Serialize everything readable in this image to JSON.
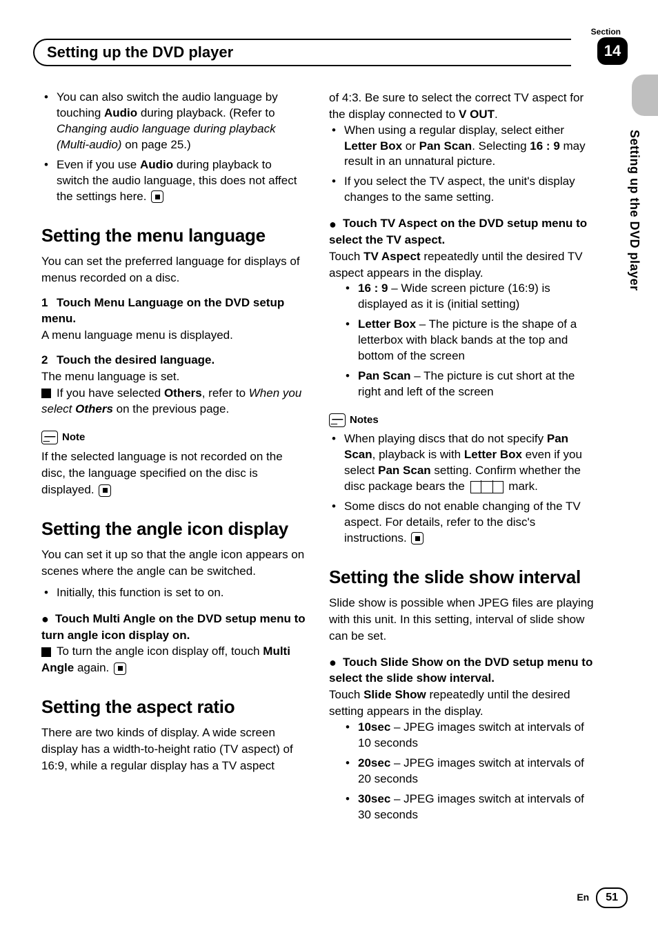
{
  "meta": {
    "section_word": "Section",
    "section_number": "14",
    "side_label": "Setting up the DVD player",
    "header_title": "Setting up the DVD player",
    "footer_lang": "En",
    "page_number": "51"
  },
  "left": {
    "top_bullets": [
      {
        "pre": "You can also switch the audio language by touching ",
        "b1": "Audio",
        "mid1": " during playback. (Refer to ",
        "i1": "Changing audio language during playback (Multi-audio)",
        "post": " on page 25.)"
      },
      {
        "pre": "Even if you use ",
        "b1": "Audio",
        "mid1": " during playback to switch the audio language, this does not affect the settings here.",
        "end_icon": true
      }
    ],
    "h_menu": "Setting the menu language",
    "p_menu": "You can set the preferred language for displays of menus recorded on a disc.",
    "step1_head": "Touch Menu Language on the DVD setup menu.",
    "step1_body": "A menu language menu is displayed.",
    "step2_head": "Touch the desired language.",
    "step2_body": "The menu language is set.",
    "step2_note_pre": "If you have selected ",
    "step2_note_b1": "Others",
    "step2_note_mid": ", refer to ",
    "step2_note_i": "When you select ",
    "step2_note_b2": "Others",
    "step2_note_post": " on the previous page.",
    "note_label": "Note",
    "note_body": "If the selected language is not recorded on the disc, the language specified on the disc is displayed.",
    "h_angle": "Setting the angle icon display",
    "p_angle": "You can set it up so that the angle icon appears on scenes where the angle can be switched.",
    "angle_b1": "Initially, this function is set to on.",
    "angle_lead": "Touch Multi Angle on the DVD setup menu to turn angle icon display on.",
    "angle_off_pre": "To turn the angle icon display off, touch ",
    "angle_off_b": "Multi Angle",
    "angle_off_post": " again.",
    "h_aspect": "Setting the aspect ratio",
    "p_aspect": "There are two kinds of display. A wide screen display has a width-to-height ratio (TV aspect) of 16:9, while a regular display has a TV aspect"
  },
  "right": {
    "p_aspect_cont_pre": "of 4:3. Be sure to select the correct TV aspect for the display connected to ",
    "p_aspect_cont_b": "V OUT",
    "p_aspect_cont_post": ".",
    "aspect_bullets": [
      {
        "pre": "When using a regular display, select either ",
        "b1": "Letter Box",
        "mid1": " or ",
        "b2": "Pan Scan",
        "mid2": ". Selecting ",
        "b3": "16 : 9",
        "post": " may result in an unnatural picture."
      },
      {
        "pre": "If you select the TV aspect, the unit's display changes to the same setting."
      }
    ],
    "aspect_lead": "Touch TV Aspect on the DVD setup menu to select the TV aspect.",
    "aspect_touch_pre": "Touch ",
    "aspect_touch_b": "TV Aspect",
    "aspect_touch_post": " repeatedly until the desired TV aspect appears in the display.",
    "aspect_options": [
      {
        "b": "16 : 9",
        "t": " – Wide screen picture (16:9) is displayed as it is (initial setting)"
      },
      {
        "b": "Letter Box",
        "t": " – The picture is the shape of a letterbox with black bands at the top and bottom of the screen"
      },
      {
        "b": "Pan Scan",
        "t": " – The picture is cut short at the right and left of the screen"
      }
    ],
    "notes_label": "Notes",
    "notes": [
      {
        "pre": "When playing discs that do not specify ",
        "b1": "Pan Scan",
        "mid1": ", playback is with ",
        "b2": "Letter Box",
        "mid2": " even if you select ",
        "b3": "Pan Scan",
        "mid3": " setting. Confirm whether the disc package bears the ",
        "mark": true,
        "post": " mark."
      },
      {
        "pre": "Some discs do not enable changing of the TV aspect. For details, refer to the disc's instructions.",
        "end_icon": true
      }
    ],
    "h_slide": "Setting the slide show interval",
    "p_slide": "Slide show is possible when JPEG files are playing with this unit. In this setting, interval of slide show can be set.",
    "slide_lead": "Touch Slide Show on the DVD setup menu to select the slide show interval.",
    "slide_touch_pre": "Touch ",
    "slide_touch_b": "Slide Show",
    "slide_touch_post": " repeatedly until the desired setting appears in the display.",
    "slide_options": [
      {
        "b": "10sec",
        "t": " – JPEG images switch at intervals of 10 seconds"
      },
      {
        "b": "20sec",
        "t": " – JPEG images switch at intervals of 20 seconds"
      },
      {
        "b": "30sec",
        "t": " – JPEG images switch at intervals of 30 seconds"
      }
    ]
  }
}
